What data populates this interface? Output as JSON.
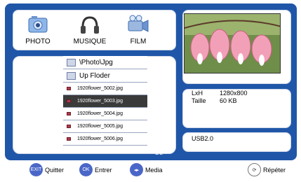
{
  "tabs": [
    {
      "label": "PHOTO",
      "icon": "camera-icon"
    },
    {
      "label": "MUSIQUE",
      "icon": "headphones-icon"
    },
    {
      "label": "FILM",
      "icon": "film-camera-icon"
    }
  ],
  "file_list": {
    "path": "\\Photo\\Jpg",
    "up_folder": "Up Floder",
    "files": [
      "1920flower_5002.jpg",
      "1920flower_5003.jpg",
      "1920flower_5004.jpg",
      "1920flower_5005.jpg",
      "1920flower_5006.jpg"
    ],
    "selected_index": 1,
    "page": "1/2"
  },
  "info": {
    "size_label": "LxH",
    "size_value": "1280x800",
    "weight_label": "Taille",
    "weight_value": "60 KB"
  },
  "device": "USB2.0",
  "bottom_bar": {
    "exit_icon": "EXIT",
    "exit_label": "Quitter",
    "ok_icon": "OK",
    "ok_label": "Entrer",
    "media_label": "Media",
    "repeat_label": "Répéter"
  },
  "colors": {
    "screen_bg": "#1f56a8",
    "selected_row": "#3a3a3a",
    "button_blue": "#4a67c8"
  }
}
